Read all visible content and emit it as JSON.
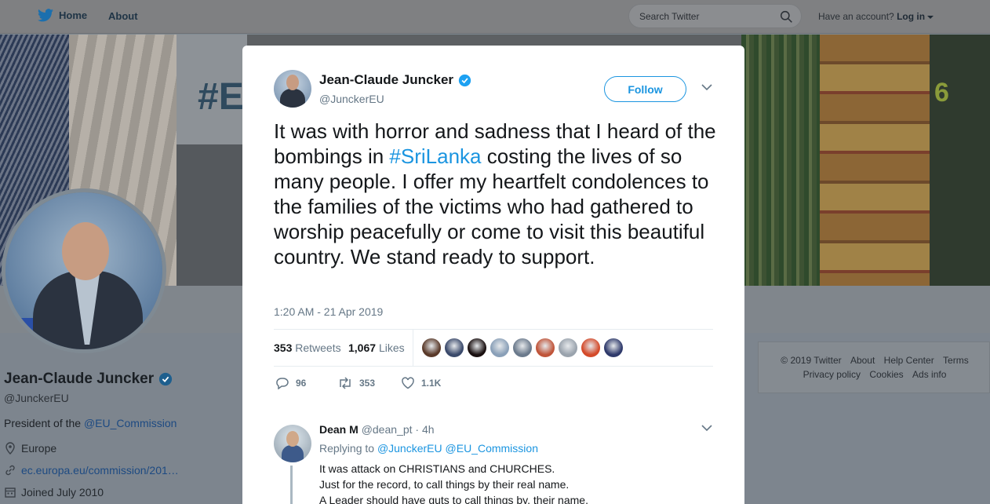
{
  "nav": {
    "home_label": "Home",
    "about_label": "About",
    "search_placeholder": "Search Twitter",
    "login_prefix": "Have an account?",
    "login_label": "Log in"
  },
  "banner": {
    "hashtag_fragment": "#E",
    "number_fragment": "6"
  },
  "profile": {
    "name": "Jean-Claude Juncker",
    "handle": "@JunckerEU",
    "bio_prefix": "President of the",
    "bio_link": "@EU_Commission",
    "location": "Europe",
    "website": "ec.europa.eu/commission/201…",
    "joined": "Joined July 2010"
  },
  "footer": {
    "copyright": "© 2019 Twitter",
    "links_row1": [
      "About",
      "Help Center",
      "Terms"
    ],
    "links_row2": [
      "Privacy policy",
      "Cookies",
      "Ads info"
    ]
  },
  "tweet": {
    "author_name": "Jean-Claude Juncker",
    "author_handle": "@JunckerEU",
    "follow_label": "Follow",
    "text_part1": "It was with horror and sadness that I heard of the bombings in ",
    "hashtag": "#SriLanka",
    "text_part2": " costing the lives of so many people. I offer my heartfelt condolences to the families of the victims who had gathered to worship peacefully or come to visit this beautiful country. We stand ready to support.",
    "timestamp": "1:20 AM - 21 Apr 2019",
    "retweets_count": "353",
    "retweets_label": "Retweets",
    "likes_count": "1,067",
    "likes_label": "Likes",
    "liker_colors": [
      "#5a3a2a",
      "#3b4a6b",
      "#1a1010",
      "#8aa0b8",
      "#6b7a8c",
      "#c0553a",
      "#9aa3ad",
      "#d44a2a",
      "#2f3a6b"
    ],
    "actions": {
      "reply_count": "96",
      "retweet_count": "353",
      "like_count": "1.1K"
    }
  },
  "reply": {
    "name": "Dean M",
    "handle": "@dean_pt",
    "time": "· 4h",
    "replying_prefix": "Replying to",
    "replying_to_1": "@JunckerEU",
    "replying_to_2": "@EU_Commission",
    "lines": [
      "It was attack on CHRISTIANS and CHURCHES.",
      "Just for the record, to call things by their real name.",
      "A Leader should have guts to call things by. their name."
    ]
  },
  "colors": {
    "twitter_blue": "#1b95e0",
    "verified_blue": "#1da1f2",
    "overlay_gray": "#7f8a93"
  }
}
